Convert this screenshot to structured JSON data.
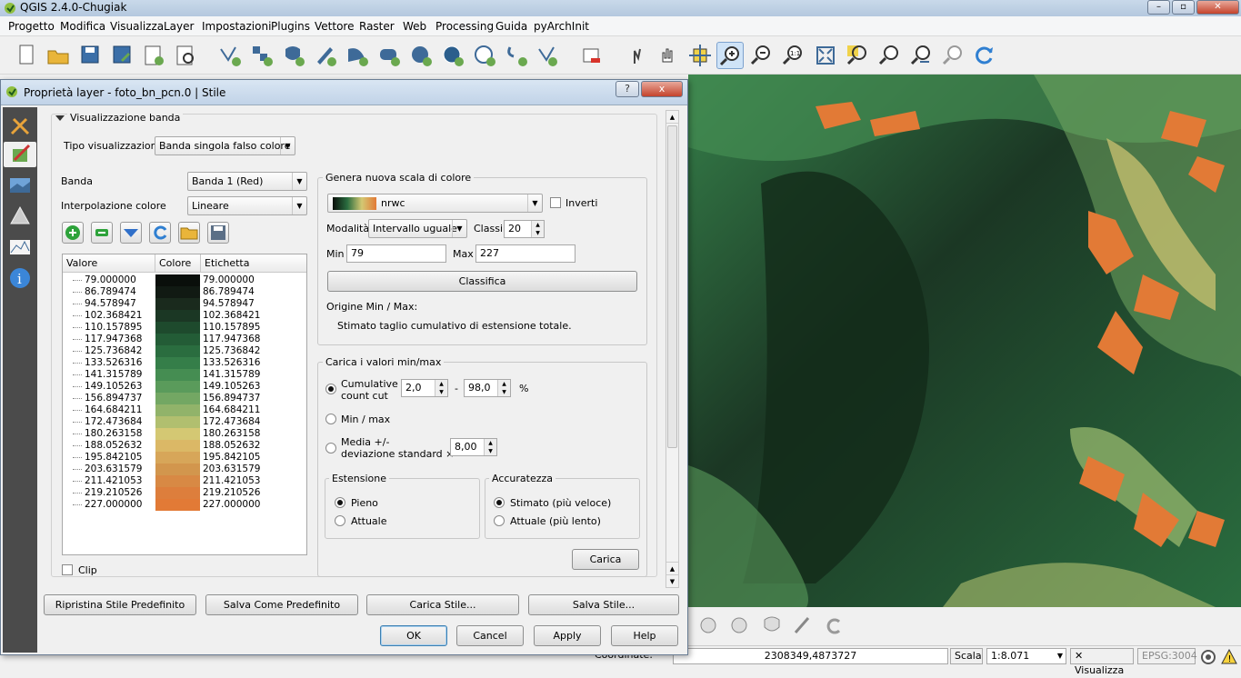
{
  "app": {
    "title": "QGIS 2.4.0-Chugiak"
  },
  "menu": [
    "Progetto",
    "Modifica",
    "Visualizza",
    "Layer",
    "Impostazioni",
    "Plugins",
    "Vettore",
    "Raster",
    "Web",
    "Processing",
    "Guida",
    "pyArchInit"
  ],
  "dialog": {
    "title": "Proprietà layer - foto_bn_pcn.0 | Stile",
    "help_btn": "?",
    "close_btn": "x",
    "section": "Visualizzazione banda",
    "tipo_label": "Tipo visualizzazione",
    "tipo_value": "Banda singola falso colore",
    "banda_label": "Banda",
    "banda_value": "Banda 1 (Red)",
    "interp_label": "Interpolazione colore",
    "interp_value": "Lineare",
    "table": {
      "headers": [
        "Valore",
        "Colore",
        "Etichetta"
      ],
      "rows": [
        {
          "v": "79.000000",
          "c": "#0a0f0b"
        },
        {
          "v": "86.789474",
          "c": "#111a13"
        },
        {
          "v": "94.578947",
          "c": "#1a2a1d"
        },
        {
          "v": "102.368421",
          "c": "#1b3724"
        },
        {
          "v": "110.157895",
          "c": "#1e4a2d"
        },
        {
          "v": "117.947368",
          "c": "#235c36"
        },
        {
          "v": "125.736842",
          "c": "#2a6d3f"
        },
        {
          "v": "133.526316",
          "c": "#357e49"
        },
        {
          "v": "141.315789",
          "c": "#458d52"
        },
        {
          "v": "149.105263",
          "c": "#5a9b5b"
        },
        {
          "v": "156.894737",
          "c": "#73a763"
        },
        {
          "v": "164.684211",
          "c": "#91b36a"
        },
        {
          "v": "172.473684",
          "c": "#b1bf6f"
        },
        {
          "v": "180.263158",
          "c": "#d4c873"
        },
        {
          "v": "188.052632",
          "c": "#dbb866"
        },
        {
          "v": "195.842105",
          "c": "#d7a659"
        },
        {
          "v": "203.631579",
          "c": "#d2964d"
        },
        {
          "v": "211.421053",
          "c": "#d88944"
        },
        {
          "v": "219.210526",
          "c": "#dd7e3c"
        },
        {
          "v": "227.000000",
          "c": "#e27a36"
        }
      ]
    },
    "clip_label": "Clip",
    "genera": {
      "title": "Genera nuova scala di colore",
      "ramp": "nrwc",
      "inverti": "Inverti",
      "modalita_label": "Modalità",
      "modalita_value": "Intervallo uguale",
      "classi_label": "Classi",
      "classi_value": "20",
      "min_label": "Min",
      "min_value": "79",
      "max_label": "Max",
      "max_value": "227",
      "classifica": "Classifica",
      "origine_label": "Origine Min / Max:",
      "origine_text": "Stimato taglio cumulativo di estensione totale."
    },
    "carica": {
      "title": "Carica i valori min/max",
      "cumulative_l1": "Cumulative",
      "cumulative_l2": "count cut",
      "cut_min": "2,0",
      "dash": "-",
      "cut_max": "98,0",
      "percent": "%",
      "minmax": "Min / max",
      "media_l1": "Media +/-",
      "media_l2": "deviazione standard ×",
      "std_value": "8,00",
      "estensione": "Estensione",
      "pieno": "Pieno",
      "attuale": "Attuale",
      "accuratezza": "Accuratezza",
      "stimato": "Stimato (più veloce)",
      "attuale_lento": "Attuale (più lento)",
      "carica_btn": "Carica"
    },
    "bottom": {
      "ripristina": "Ripristina Stile Predefinito",
      "salva_predef": "Salva Come Predefinito",
      "carica_stile": "Carica Stile...",
      "salva_stile": "Salva Stile...",
      "ok": "OK",
      "cancel": "Cancel",
      "apply": "Apply",
      "help": "Help"
    }
  },
  "status": {
    "coord_label": "Coordinate:",
    "coords": "2308349,4873727",
    "scala_label": "Scala",
    "scala_value": "1:8.071",
    "render_label": "Visualizza",
    "crs": "EPSG:3004"
  },
  "colors": {
    "accent": "#e27a36",
    "dark_green": "#1e4a2d",
    "light": "#d4c873"
  }
}
